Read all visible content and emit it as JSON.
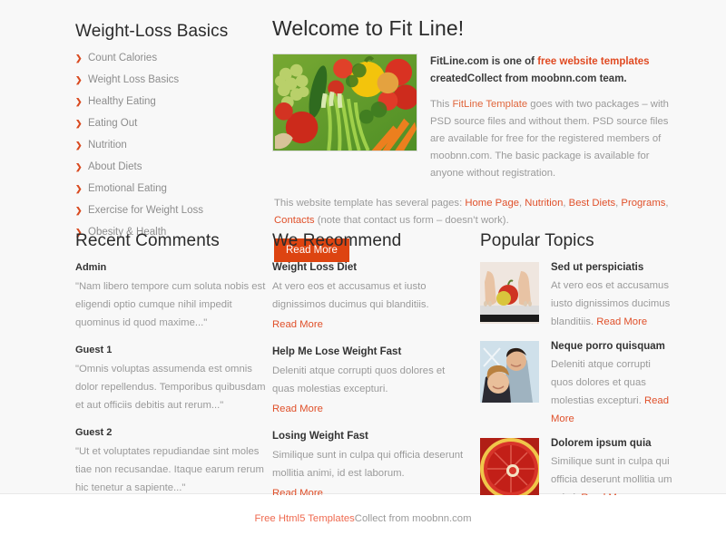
{
  "sidebar": {
    "title": "Weight-Loss Basics",
    "bullet_glyph": "❯",
    "items": [
      {
        "label": "Count Calories"
      },
      {
        "label": "Weight Loss Basics"
      },
      {
        "label": "Healthy Eating"
      },
      {
        "label": "Eating Out"
      },
      {
        "label": "Nutrition"
      },
      {
        "label": "About Diets"
      },
      {
        "label": "Emotional Eating"
      },
      {
        "label": "Exercise for Weight Loss"
      },
      {
        "label": "Obesity & Health"
      }
    ]
  },
  "welcome": {
    "title": "Welcome to Fit Line!",
    "image_alt": "fresh-vegetables-photo",
    "lead_part1": "FitLine.com is one of ",
    "lead_link": "free website templates",
    "lead_part2": "createdCollect from moobnn.com team.",
    "body_part1": "This ",
    "body_link": "FitLine Template",
    "body_part2": " goes with two packages – with PSD source files and without them. PSD source files are available for free for the registered members of moobnn.com. The basic package is available for anyone without registration.",
    "pages_prefix": "This website template has several pages: ",
    "page_links": [
      "Home Page",
      "Nutrition",
      "Best Diets",
      "Programs",
      "Contacts"
    ],
    "pages_suffix": " (note that contact us form – doesn’t work).",
    "read_more_button": "Read More"
  },
  "recent_comments": {
    "title": "Recent Comments",
    "comments": [
      {
        "author": "Admin",
        "text": "\"Nam libero tempore cum soluta nobis est eligendi optio cumque nihil impedit quominus id quod maxime...\""
      },
      {
        "author": "Guest 1",
        "text": "\"Omnis voluptas assumenda est omnis dolor repellendus. Temporibus quibusdam et aut officiis debitis aut rerum...\""
      },
      {
        "author": "Guest 2",
        "text": "\"Ut et voluptates repudiandae sint moles tiae non recusandae. Itaque earum rerum hic tenetur a sapiente...\""
      }
    ]
  },
  "we_recommend": {
    "title": "We Recommend",
    "read_more_label": "Read More",
    "items": [
      {
        "title": "Weight Loss Diet",
        "text": "At vero eos et accusamus et iusto dignissimos ducimus qui blanditiis."
      },
      {
        "title": "Help Me Lose Weight Fast",
        "text": "Deleniti atque corrupti quos dolores et quas molestias excepturi."
      },
      {
        "title": "Losing Weight Fast",
        "text": "Similique sunt in culpa qui officia deserunt mollitia animi, id est laborum."
      }
    ]
  },
  "popular_topics": {
    "title": "Popular Topics",
    "read_more_label": "Read More",
    "items": [
      {
        "title": "Sed ut perspiciatis",
        "text": "At vero eos et accusamus iusto dignissimos ducimus blanditiis. ",
        "image_alt": "feet-on-scale-with-apple-photo"
      },
      {
        "title": "Neque porro quisquam",
        "text": "Deleniti atque corrupti quos dolores et quas molestias excepturi. ",
        "image_alt": "smiling-couple-photo"
      },
      {
        "title": "Dolorem ipsum quia",
        "text": "Similique sunt in culpa qui officia deserunt mollitia um animi. ",
        "image_alt": "grapefruit-half-photo"
      }
    ]
  },
  "footer": {
    "link_text": "Free Html5 Templates",
    "text": "Collect from moobnn.com"
  },
  "colors": {
    "accent": "#dd4411",
    "link": "#e0502a",
    "body_text": "#9a9a9a",
    "heading": "#2b2b2b",
    "page_bg": "#f8f8f8"
  }
}
